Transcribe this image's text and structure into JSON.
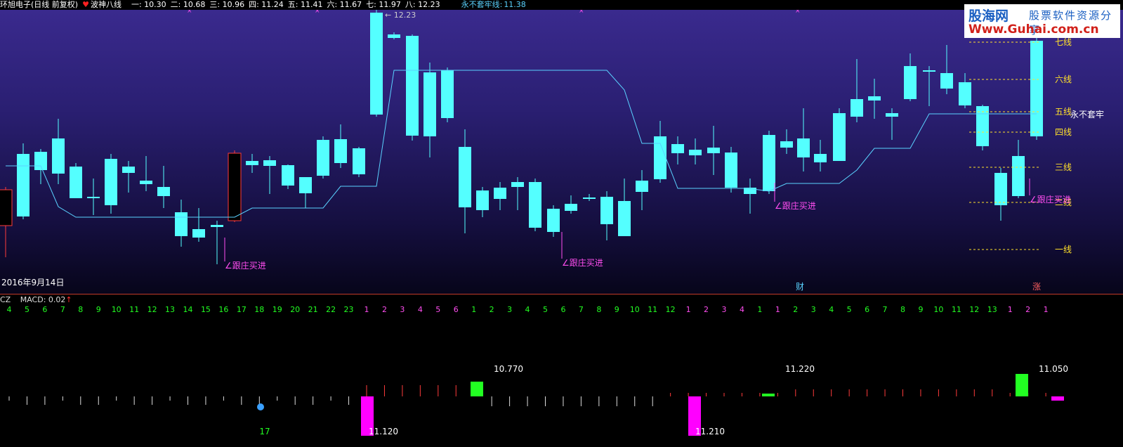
{
  "header": {
    "title": "环旭电子(日线 前复权)",
    "indicator_icon": "heart-icon",
    "indicator_name": "波神八线",
    "lines": [
      {
        "label": "一",
        "value": "10.30"
      },
      {
        "label": "二",
        "value": "10.68"
      },
      {
        "label": "三",
        "value": "10.96"
      },
      {
        "label": "四",
        "value": "11.24"
      },
      {
        "label": "五",
        "value": "11.41"
      },
      {
        "label": "六",
        "value": "11.67"
      },
      {
        "label": "七",
        "value": "11.97"
      },
      {
        "label": "八",
        "value": "12.23"
      }
    ],
    "stop_label": "永不套牢线",
    "stop_value": "11.38"
  },
  "logo": {
    "brand": "股海网",
    "slogan": "股票软件资源分享",
    "url": "Www.Guhai.com.cn"
  },
  "main": {
    "peak_label": "12.23",
    "date_label": "2016年9月14日",
    "buy_signal": "跟庄买进",
    "level_lines": [
      "七线",
      "六线",
      "五线",
      "四线",
      "三线",
      "二线",
      "一线"
    ],
    "stop_side_label": "永不套牢",
    "bottom_markers": [
      "财",
      "涨"
    ]
  },
  "sub": {
    "indicator": "CZ",
    "macd_label": "MACD: 0.02",
    "arrow_icon": "arrow-up-icon",
    "counts": [
      "4",
      "5",
      "6",
      "7",
      "8",
      "9",
      "10",
      "11",
      "12",
      "13",
      "14",
      "15",
      "16",
      "17",
      "18",
      "19",
      "20",
      "21",
      "22",
      "23",
      "1",
      "2",
      "3",
      "4",
      "5",
      "6",
      "1",
      "2",
      "3",
      "4",
      "5",
      "6",
      "7",
      "8",
      "9",
      "10",
      "11",
      "12",
      "1",
      "2",
      "3",
      "4",
      "1",
      "1",
      "2",
      "3",
      "4",
      "5",
      "6",
      "7",
      "8",
      "9",
      "10",
      "11",
      "12",
      "13",
      "1",
      "2",
      "1"
    ],
    "value_labels": [
      "10.770",
      "11.220",
      "11.050",
      "11.120",
      "11.210",
      "17"
    ]
  },
  "colors": {
    "up": "#ff3b3b",
    "down": "#54ffff",
    "line": "#5ad2ff",
    "level": "#ffe02a",
    "signal": "#ff4df0",
    "green_bar": "#22ff22",
    "magenta_bar": "#ff00ff"
  }
}
